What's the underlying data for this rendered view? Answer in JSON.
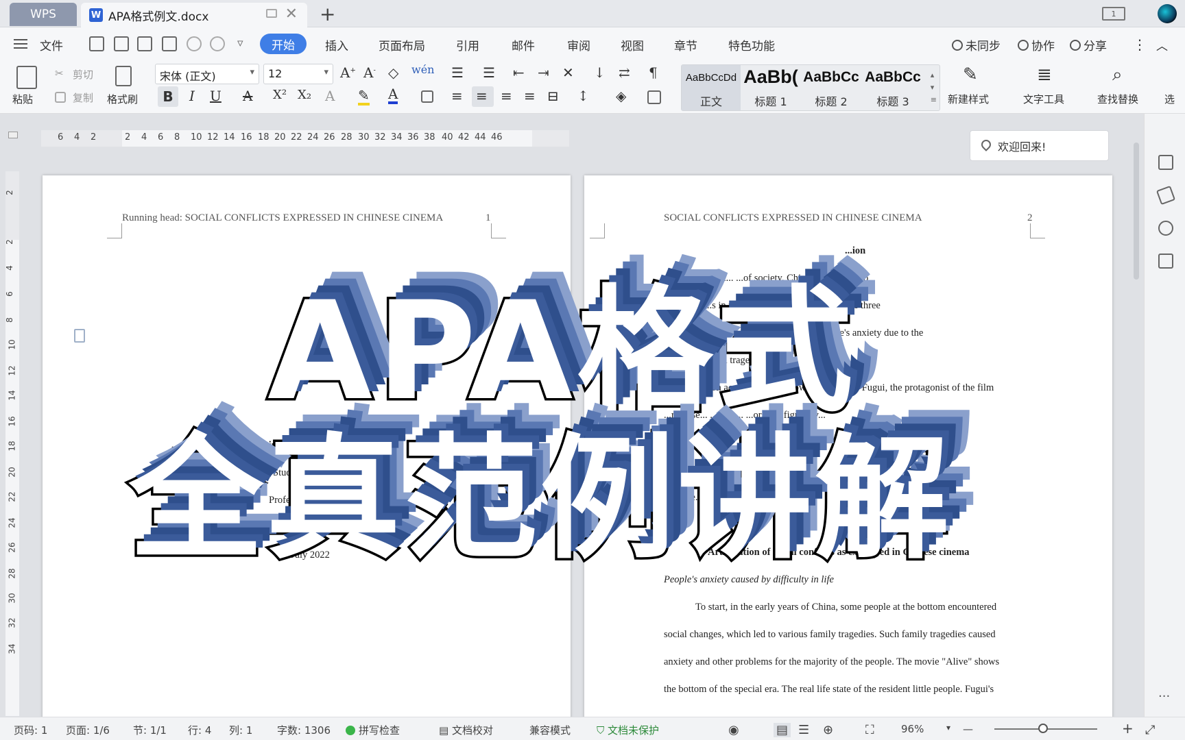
{
  "titlebar": {
    "wps_label": "WPS",
    "doc_tab": "APA格式例文.docx",
    "doc_icon": "W",
    "close": "✕",
    "add": "+",
    "layout_label": "1"
  },
  "menu": {
    "file": "文件",
    "items": [
      "开始",
      "插入",
      "页面布局",
      "引用",
      "邮件",
      "审阅",
      "视图",
      "章节",
      "特色功能"
    ],
    "right": [
      "未同步",
      "协作",
      "分享"
    ],
    "more": "⋮",
    "collapse": "︿"
  },
  "ribbon": {
    "paste": "粘贴",
    "cut": "剪切",
    "copy": "复制",
    "format_painter": "格式刷",
    "font_name": "宋体 (正文)",
    "font_size": "12",
    "bold": "B",
    "italic": "I",
    "underline": "U",
    "strike": "A",
    "superscript": "X²",
    "subscript": "X₂",
    "styles": [
      {
        "preview": "AaBbCcDd",
        "label": "正文"
      },
      {
        "preview": "AaBb(",
        "label": "标题 1"
      },
      {
        "preview": "AaBbCc",
        "label": "标题 2"
      },
      {
        "preview": "AaBbCc",
        "label": "标题 3"
      }
    ],
    "new_style": "新建样式",
    "text_tool": "文字工具",
    "find_replace": "查找替换",
    "select": "选"
  },
  "ruler": {
    "ticks": [
      "6",
      "4",
      "2",
      "2",
      "4",
      "6",
      "8",
      "10",
      "12",
      "14",
      "16",
      "18",
      "20",
      "22",
      "24",
      "26",
      "28",
      "30",
      "32",
      "34",
      "36",
      "38",
      "40",
      "42",
      "44",
      "46"
    ],
    "vticks": [
      "2",
      "2",
      "4",
      "6",
      "8",
      "10",
      "12",
      "14",
      "16",
      "18",
      "20",
      "22",
      "24",
      "26",
      "28",
      "30",
      "32",
      "34"
    ]
  },
  "welcome": "欢迎回来!",
  "page1": {
    "header": "Running head: SOCIAL CONFLICTS EXPRESSED IN CHINESE CINEMA",
    "page_num": "1",
    "lines": [
      "...ulation ...nflicts ...e Cinema",
      "Studen...",
      "Profe...",
      "Co...",
      "13 July 2022"
    ]
  },
  "page2": {
    "header": "SOCIAL CONFLICTS EXPRESSED IN CHINESE CINEMA",
    "page_num": "2",
    "lines": [
      "...ion",
      "...ertai... ...of society. Chinese movies also",
      "...social... ...s in their era. This essay will explore three",
      "...contradic... ...nve... ...Chinese films: people's anxiety due to the",
      "...de... ...storical tragedies, and women's",
      "discrimination accompanied by low social status. Fugui, the protagonist of the film",
      "...represe... ...of th... ...or... ...l figures v...",
      "...s' exte... ...nd...",
      "...od, fin... ...f...",
      "...rly tre... ...nst a...",
      "suic..."
    ],
    "section_title": "Articulation of social conflicts as expressed in Chinese cinema",
    "subheading": "People's anxiety caused by difficulty in life",
    "para": [
      "To start, in the early years of China, some people at the bottom encountered",
      "social changes, which led to various family tragedies. Such family tragedies caused",
      "anxiety and other problems for the majority of the people. The movie \"Alive\" shows",
      "the bottom of the special era. The real life state of the resident little people. Fugui's"
    ]
  },
  "overlay": {
    "line1": "APA格式",
    "line2": "全真范例讲解"
  },
  "status": {
    "page_code": "页码: 1",
    "page": "页面: 1/6",
    "section": "节: 1/1",
    "row": "行: 4",
    "col": "列: 1",
    "words": "字数: 1306",
    "spell": "拼写检查",
    "proof": "文档校对",
    "compat": "兼容模式",
    "protect": "文档未保护",
    "zoom": "96%",
    "minus": "—",
    "plus": "+"
  },
  "colors": {
    "accent": "#3f7ee6",
    "overlay_shadow": "#3b5b9a",
    "green": "#3bb54a"
  }
}
